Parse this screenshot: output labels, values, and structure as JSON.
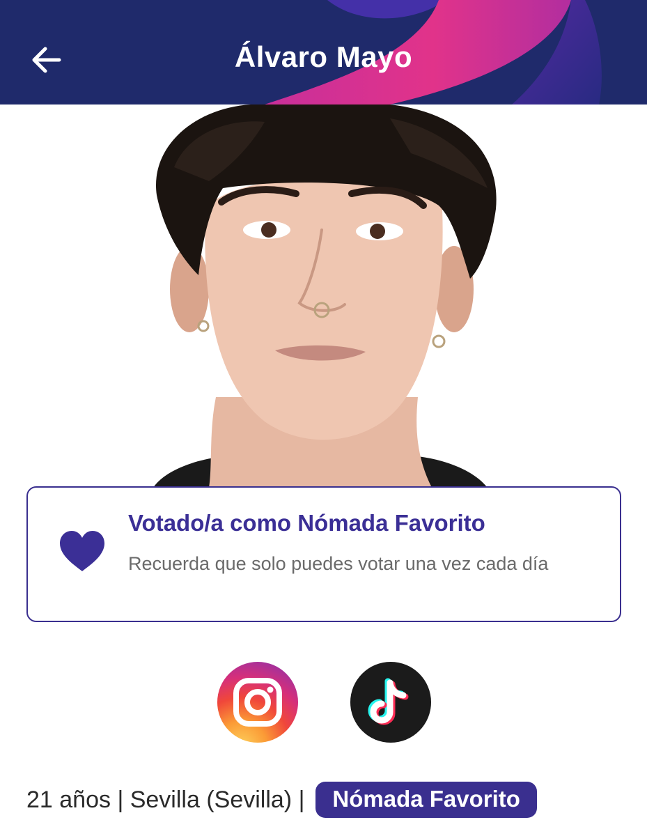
{
  "header": {
    "title": "Álvaro Mayo",
    "back_icon": "arrow-left-icon",
    "background_color": "#1f2a6b",
    "accent_color": "#e0308a"
  },
  "portrait": {
    "icon": "contestant-photo"
  },
  "vote_card": {
    "icon": "heart-icon",
    "title": "Votado/a como Nómada Favorito",
    "subtitle": "Recuerda que solo puedes votar una vez cada día",
    "accent_color": "#3b2f96"
  },
  "social": {
    "instagram_icon": "instagram-icon",
    "tiktok_icon": "tiktok-icon"
  },
  "info": {
    "age_location": "21 años | Sevilla (Sevilla) |",
    "badge": "Nómada Favorito",
    "badge_color": "#3a2f8f"
  }
}
